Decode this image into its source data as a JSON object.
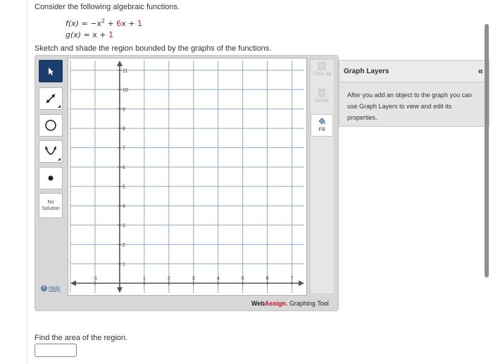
{
  "question": {
    "intro": "Consider the following algebraic functions.",
    "f_label": "f(x)",
    "f_eq_pre": "=  −x",
    "f_exp": "2",
    "f_eq_mid": " + ",
    "f_coef": "6",
    "f_eq_x": "x + ",
    "f_const": "1",
    "g_label": "g(x)",
    "g_eq_pre": "=  x + ",
    "g_const": "1",
    "sketch": "Sketch and shade the region bounded by the graphs of the functions.",
    "area": "Find the area of the region."
  },
  "graph_tool": {
    "tools": [
      "pointer-icon",
      "line-arrow-icon",
      "circle-icon",
      "parabola-icon",
      "point-icon"
    ],
    "no_solution_line1": "No",
    "no_solution_line2": "Solution",
    "help": "Help",
    "clear_all": "Clear All",
    "delete": "Delete",
    "fill": "Fill",
    "brand_web": "Web",
    "brand_assign": "Assign.",
    "brand_tool": " Graphing Tool",
    "x_ticks": [
      "-1",
      "1",
      "2",
      "3",
      "4",
      "5",
      "6",
      "7"
    ],
    "y_ticks": [
      "1",
      "2",
      "3",
      "4",
      "5",
      "6",
      "7",
      "8",
      "9",
      "10",
      "11"
    ],
    "x_range": [
      -2,
      7.5
    ],
    "y_range": [
      -0.5,
      11.5
    ],
    "grid": true
  },
  "graph_layers": {
    "title": "Graph Layers",
    "collapse": "«",
    "body": "After you add an object to the graph you can use Graph Layers to view and edit its properties."
  },
  "answer": {
    "value": ""
  }
}
